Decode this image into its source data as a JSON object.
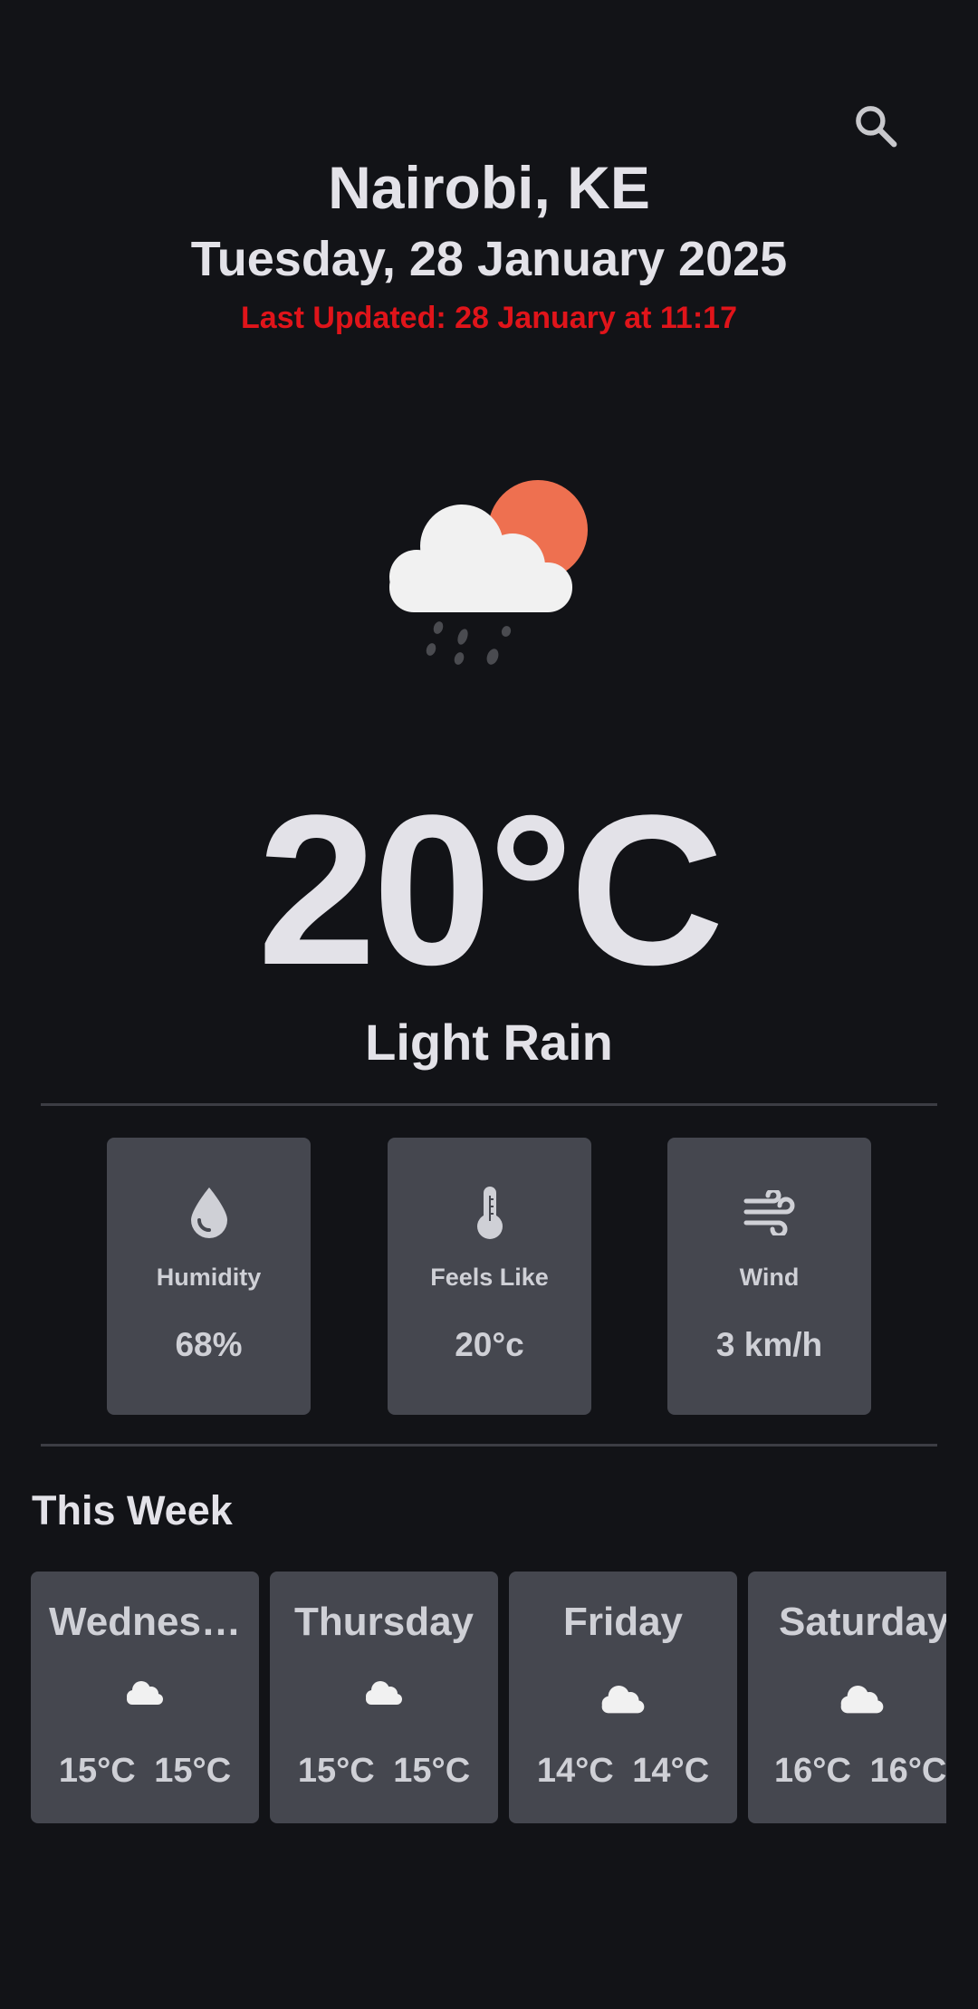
{
  "location": {
    "city": "Nairobi, KE",
    "date": "Tuesday, 28 January 2025",
    "last_updated": "Last Updated: 28 January at 11:17"
  },
  "current": {
    "icon": "cloud-sun-rain-icon",
    "temperature": "20°C",
    "condition": "Light Rain"
  },
  "stats": [
    {
      "icon": "water-drop-icon",
      "label": "Humidity",
      "value": "68%"
    },
    {
      "icon": "thermometer-icon",
      "label": "Feels Like",
      "value": "20°c"
    },
    {
      "icon": "wind-icon",
      "label": "Wind",
      "value": "3 km/h"
    }
  ],
  "week": {
    "title": "This Week",
    "days": [
      {
        "name": "Wednes…",
        "icon": "cloud-icon",
        "temp_a": "15°C",
        "temp_b": "15°C"
      },
      {
        "name": "Thursday",
        "icon": "cloud-icon",
        "temp_a": "15°C",
        "temp_b": "15°C"
      },
      {
        "name": "Friday",
        "icon": "cloud-icon",
        "temp_a": "14°C",
        "temp_b": "14°C"
      },
      {
        "name": "Saturday",
        "icon": "cloud-icon",
        "temp_a": "16°C",
        "temp_b": "16°C"
      }
    ]
  },
  "colors": {
    "background": "#121317",
    "card": "#45474f",
    "text": "#e3e2e8",
    "updated_text": "#e0141a",
    "sun": "#ee7050"
  }
}
